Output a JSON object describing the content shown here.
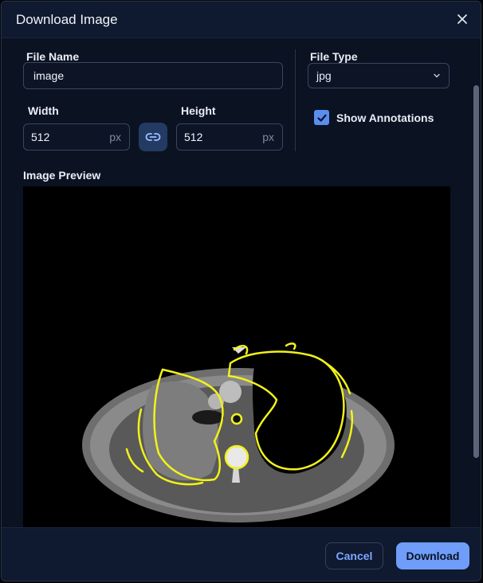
{
  "dialog": {
    "title": "Download Image",
    "close_icon": "close-icon"
  },
  "form": {
    "file_name_label": "File Name",
    "file_name_value": "image",
    "width_label": "Width",
    "width_value": "512",
    "width_unit": "px",
    "height_label": "Height",
    "height_value": "512",
    "height_unit": "px",
    "link_icon": "link-icon",
    "file_type_label": "File Type",
    "file_type_value": "jpg",
    "show_annotations_label": "Show Annotations",
    "show_annotations_checked": true
  },
  "preview": {
    "label": "Image Preview",
    "image_kind": "axial chest CT slice with yellow annotation contours"
  },
  "footer": {
    "cancel_label": "Cancel",
    "download_label": "Download"
  },
  "colors": {
    "accent": "#6f9df8",
    "annotation": "#f2f21a",
    "background": "#0b1222"
  }
}
